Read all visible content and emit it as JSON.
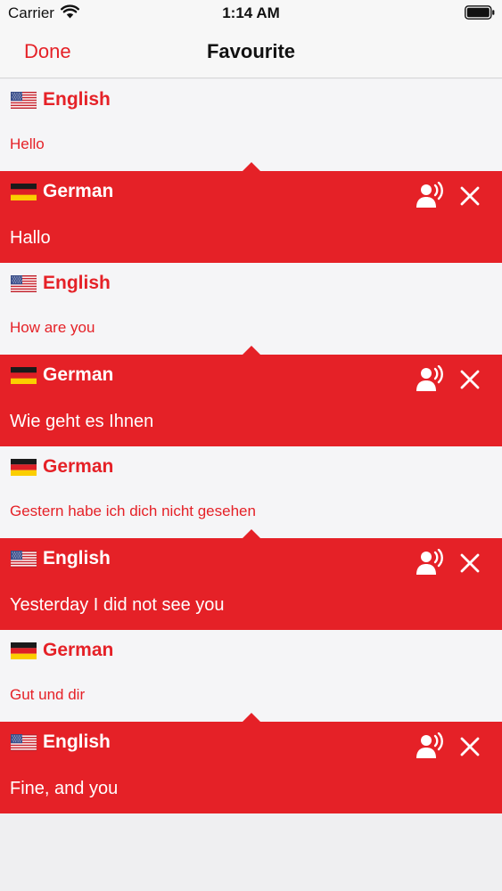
{
  "status": {
    "carrier": "Carrier",
    "time": "1:14 AM"
  },
  "nav": {
    "done_label": "Done",
    "title": "Favourite"
  },
  "colors": {
    "accent": "#e52127",
    "light_row": "#f5f5f7"
  },
  "rows": [
    {
      "style": "light",
      "flag": "us-flag-icon",
      "language": "English",
      "text": "Hello"
    },
    {
      "style": "red",
      "flag": "de-flag-icon",
      "language": "German",
      "text": "Hallo"
    },
    {
      "style": "light",
      "flag": "us-flag-icon",
      "language": "English",
      "text": "How are you"
    },
    {
      "style": "red",
      "flag": "de-flag-icon",
      "language": "German",
      "text": "Wie geht es Ihnen"
    },
    {
      "style": "light",
      "flag": "de-flag-icon",
      "language": "German",
      "text": "Gestern habe ich dich nicht gesehen"
    },
    {
      "style": "red",
      "flag": "us-flag-icon",
      "language": "English",
      "text": "Yesterday I did not see you"
    },
    {
      "style": "light",
      "flag": "de-flag-icon",
      "language": "German",
      "text": "Gut und dir"
    },
    {
      "style": "red",
      "flag": "us-flag-icon",
      "language": "English",
      "text": "Fine, and you"
    }
  ]
}
